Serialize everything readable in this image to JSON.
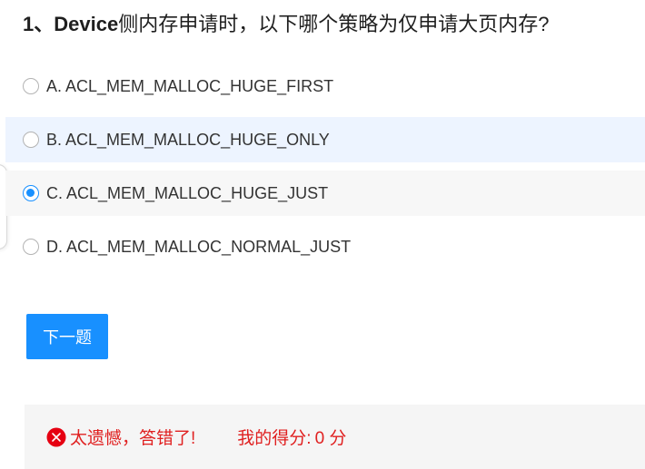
{
  "question": {
    "number": "1、",
    "text_prefix": "Device",
    "text": "侧内存申请时，以下哪个策略为仅申请大页内存?"
  },
  "options": [
    {
      "label": "A. ACL_MEM_MALLOC_HUGE_FIRST",
      "checked": false
    },
    {
      "label": "B. ACL_MEM_MALLOC_HUGE_ONLY",
      "checked": false
    },
    {
      "label": "C. ACL_MEM_MALLOC_HUGE_JUST",
      "checked": true
    },
    {
      "label": "D. ACL_MEM_MALLOC_NORMAL_JUST",
      "checked": false
    }
  ],
  "next_button": {
    "label": "下一题"
  },
  "result": {
    "icon": "error-x-icon",
    "message": "太遗憾，答错了!",
    "score_label": "我的得分:",
    "score_value": "0 分"
  },
  "colors": {
    "accent": "#1890ff",
    "error": "#e02020",
    "hover_bg": "#edf4ff",
    "selected_bg": "#f7f7f7",
    "result_bg": "#f5f5f5"
  }
}
